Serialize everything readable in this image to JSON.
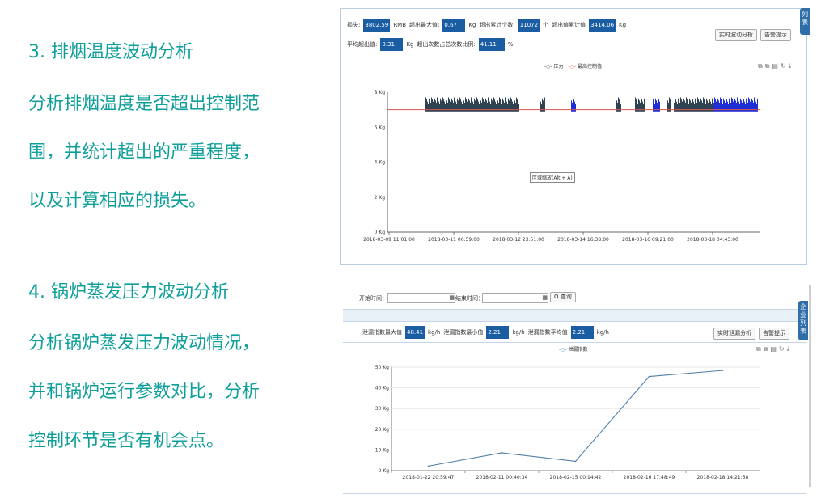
{
  "left": {
    "section3": {
      "title": "3. 排烟温度波动分析",
      "lines": [
        "分析排烟温度是否超出控制范",
        "围，并统计超出的严重程度，",
        "以及计算相应的损失。"
      ]
    },
    "section4": {
      "title": "4. 锅炉蒸发压力波动分析",
      "lines": [
        "分析锅炉蒸发压力波动情况，",
        "并和锅炉运行参数对比，分析",
        "控制环节是否有机会点。"
      ]
    }
  },
  "panel1": {
    "side_tab": "列表",
    "row1": [
      {
        "label": "损失:",
        "value": "3802.59",
        "unit": "RMB"
      },
      {
        "label": "超出最大值:",
        "value": "0.67",
        "unit": "Kg"
      },
      {
        "label": "超出累计个数:",
        "value": "11072",
        "unit": "个"
      },
      {
        "label": "超出值累计值",
        "value": "3414.06",
        "unit": "Kg"
      }
    ],
    "row2": [
      {
        "label": "平均超出值:",
        "value": "0.31",
        "unit": "Kg"
      },
      {
        "label": "超出次数占总次数比例:",
        "value": "41.11",
        "unit": "%"
      }
    ],
    "btn_realtime": "实时波动分析",
    "btn_alarm": "告警提示",
    "legend": [
      "压力",
      "最高控制值"
    ],
    "toolbox_icons": "⧉⧉▤↻⤓",
    "tooltip": "区域缩放(Alt + A)",
    "chart_data": {
      "type": "area",
      "y_ticks": [
        "0 Kg",
        "2 Kg",
        "4 Kg",
        "6 Kg",
        "8 Kg"
      ],
      "x_ticks": [
        "2018-03-09 11:01:00",
        "2018-03-11 06:59:00",
        "2018-03-12 23:51:00",
        "2018-03-14 16:38:00",
        "2018-03-16 09:21:00",
        "2018-03-18 04:43:00"
      ],
      "ylim": [
        0,
        8
      ],
      "control_value": 7,
      "series": [
        {
          "name": "压力",
          "approx_level": [
            7.1,
            7.7
          ]
        },
        {
          "name": "最高控制值",
          "value": 7
        }
      ],
      "colors": {
        "pressure_dark": "#2f4353",
        "pressure_blue": "#1e2fd6",
        "control": "#d9544f"
      }
    }
  },
  "panel2": {
    "side_tab": "企业列表",
    "start_label": "开始时间：",
    "end_label": "结束时间：",
    "calendar_icon": "▦",
    "query_label": "Q 查询",
    "stats": [
      {
        "label": "泄漏指数最大值",
        "value": "48.41",
        "unit": "kg/h"
      },
      {
        "label": "泄漏指数最小值",
        "value": "2.21",
        "unit": "kg/h"
      },
      {
        "label": "泄漏指数平均值",
        "value": "2.21",
        "unit": "kg/h"
      }
    ],
    "btn_realtime": "实时泄漏分析",
    "btn_alarm": "告警提示",
    "legend": [
      "泄漏指数"
    ],
    "toolbox_icons": "⧉⧉▤↻⤓",
    "chart_data": {
      "type": "line",
      "x": [
        "2018-01-22 20:59:47",
        "2018-02-11 00:40:34",
        "2018-02-15 00:14:42",
        "2018-02-16 17:48:49",
        "2018-02-18 14:21:58"
      ],
      "series": [
        {
          "name": "泄漏指数",
          "values": [
            2.2,
            8.6,
            4.5,
            45.5,
            48.4
          ]
        }
      ],
      "y_ticks": [
        "0 Kg",
        "10 Kg",
        "20 Kg",
        "30 Kg",
        "40 Kg",
        "50 Kg"
      ],
      "ylim": [
        0,
        50
      ],
      "color": "#4f7fa8"
    }
  }
}
